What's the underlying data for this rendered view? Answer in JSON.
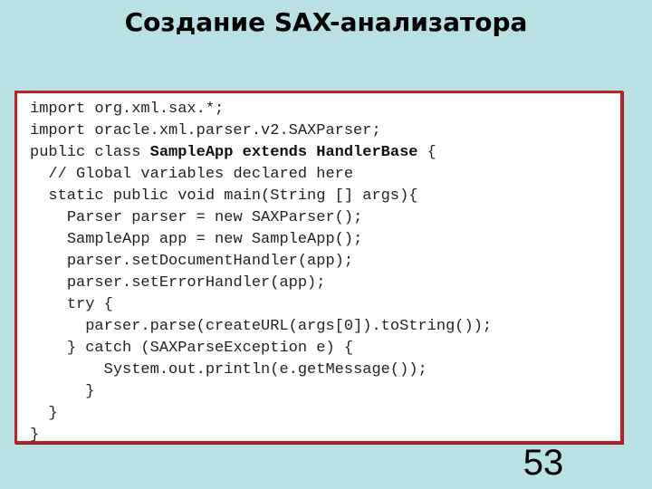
{
  "slide": {
    "title": "Создание SAX-анализатора",
    "page_number": "53",
    "colors": {
      "background": "#b9e0e2",
      "code_box_border": "#b8242a",
      "code_box_background": "#ffffff"
    }
  },
  "code": {
    "language": "java",
    "lines": [
      {
        "indent": "",
        "segments": [
          {
            "text": "import org.xml.sax.*;",
            "bold": false
          }
        ]
      },
      {
        "indent": "",
        "segments": [
          {
            "text": "import oracle.xml.parser.v2.SAXParser;",
            "bold": false
          }
        ]
      },
      {
        "indent": "",
        "segments": [
          {
            "text": "public class ",
            "bold": false
          },
          {
            "text": "SampleApp extends HandlerBase",
            "bold": true
          },
          {
            "text": " {",
            "bold": false
          }
        ]
      },
      {
        "indent": "  ",
        "segments": [
          {
            "text": "// Global variables declared here",
            "bold": false
          }
        ]
      },
      {
        "indent": "  ",
        "segments": [
          {
            "text": "static public void main(String [] args){",
            "bold": false
          }
        ]
      },
      {
        "indent": "    ",
        "segments": [
          {
            "text": "Parser parser = new SAXParser();",
            "bold": false
          }
        ]
      },
      {
        "indent": "    ",
        "segments": [
          {
            "text": "SampleApp app = new SampleApp();",
            "bold": false
          }
        ]
      },
      {
        "indent": "    ",
        "segments": [
          {
            "text": "parser.setDocumentHandler(app);",
            "bold": false
          }
        ]
      },
      {
        "indent": "    ",
        "segments": [
          {
            "text": "parser.setErrorHandler(app);",
            "bold": false
          }
        ]
      },
      {
        "indent": "    ",
        "segments": [
          {
            "text": "try {",
            "bold": false
          }
        ]
      },
      {
        "indent": "      ",
        "segments": [
          {
            "text": "parser.parse(createURL(args[0]).toString());",
            "bold": false
          }
        ]
      },
      {
        "indent": "    ",
        "segments": [
          {
            "text": "} catch (SAXParseException e) {",
            "bold": false
          }
        ]
      },
      {
        "indent": "        ",
        "segments": [
          {
            "text": "System.out.println(e.getMessage());",
            "bold": false
          }
        ]
      },
      {
        "indent": "      ",
        "segments": [
          {
            "text": "}",
            "bold": false
          }
        ]
      },
      {
        "indent": "  ",
        "segments": [
          {
            "text": "}",
            "bold": false
          }
        ]
      },
      {
        "indent": "",
        "segments": [
          {
            "text": "}",
            "bold": false
          }
        ]
      }
    ]
  }
}
